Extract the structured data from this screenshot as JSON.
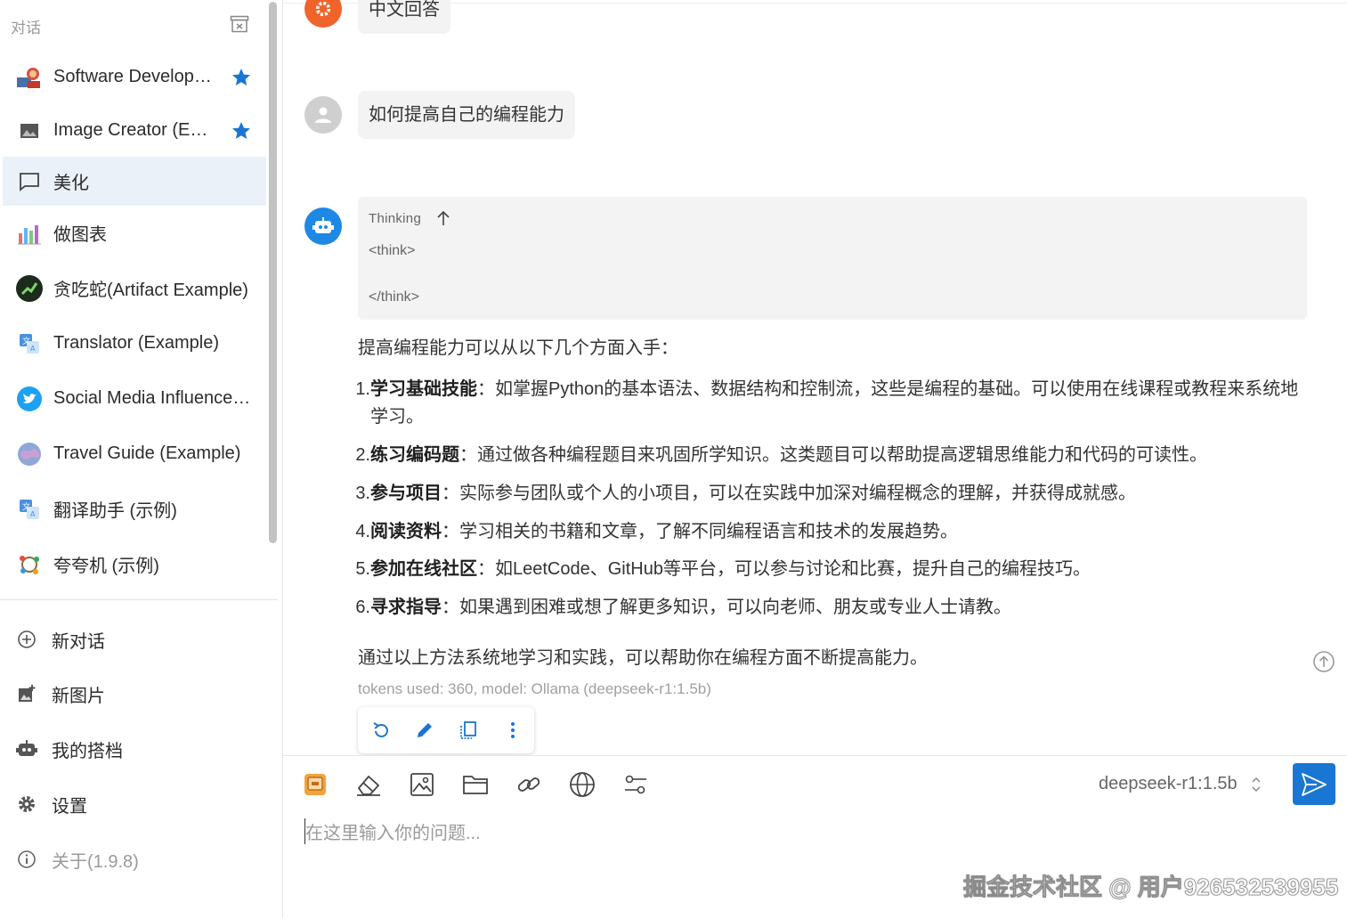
{
  "sidebar": {
    "header": "对话",
    "conversations": [
      {
        "label": "Software Develop…",
        "starred": true
      },
      {
        "label": "Image Creator (E…",
        "starred": true
      },
      {
        "label": "美化",
        "starred": false,
        "active": true
      },
      {
        "label": "做图表",
        "starred": false
      },
      {
        "label": "贪吃蛇(Artifact Example)",
        "starred": false
      },
      {
        "label": "Translator (Example)",
        "starred": false
      },
      {
        "label": "Social Media Influence…",
        "starred": false
      },
      {
        "label": "Travel Guide (Example)",
        "starred": false
      },
      {
        "label": "翻译助手 (示例)",
        "starred": false
      },
      {
        "label": "夸夸机 (示例)",
        "starred": false
      }
    ],
    "menu": {
      "new_chat": "新对话",
      "new_image": "新图片",
      "my_copilots": "我的搭档",
      "settings": "设置",
      "about": "关于(1.9.8)"
    }
  },
  "chat": {
    "prev_bubble": "中文回答",
    "user_message": "如何提高自己的编程能力",
    "thinking": {
      "title": "Thinking",
      "line1": "<think>",
      "line2": "</think>"
    },
    "answer_intro": "提高编程能力可以从以下几个方面入手：",
    "items": [
      {
        "num": "1.",
        "title": "学习基础技能",
        "text": "：如掌握Python的基本语法、数据结构和控制流，这些是编程的基础。可以使用在线课程或教程来系统地学习。"
      },
      {
        "num": "2.",
        "title": "练习编码题",
        "text": "：通过做各种编程题目来巩固所学知识。这类题目可以帮助提高逻辑思维能力和代码的可读性。"
      },
      {
        "num": "3.",
        "title": "参与项目",
        "text": "：实际参与团队或个人的小项目，可以在实践中加深对编程概念的理解，并获得成就感。"
      },
      {
        "num": "4.",
        "title": "阅读资料",
        "text": "：学习相关的书籍和文章，了解不同编程语言和技术的发展趋势。"
      },
      {
        "num": "5.",
        "title": "参加在线社区",
        "text": "：如LeetCode、GitHub等平台，可以参与讨论和比赛，提升自己的编程技巧。"
      },
      {
        "num": "6.",
        "title": "寻求指导",
        "text": "：如果遇到困难或想了解更多知识，可以向老师、朋友或专业人士请教。"
      }
    ],
    "answer_outro": "通过以上方法系统地学习和实践，可以帮助你在编程方面不断提高能力。",
    "tokens": "tokens used: 360, model: Ollama (deepseek-r1:1.5b)"
  },
  "input": {
    "model": "deepseek-r1:1.5b",
    "placeholder": "在这里输入你的问题..."
  },
  "watermark": "掘金技术社区 @ 用户926532539955",
  "colors": {
    "accent": "#1976d2",
    "bot_avatar": "#1e88e5",
    "user_avatar": "#cfcfcf",
    "prev_avatar": "#f0642b"
  }
}
